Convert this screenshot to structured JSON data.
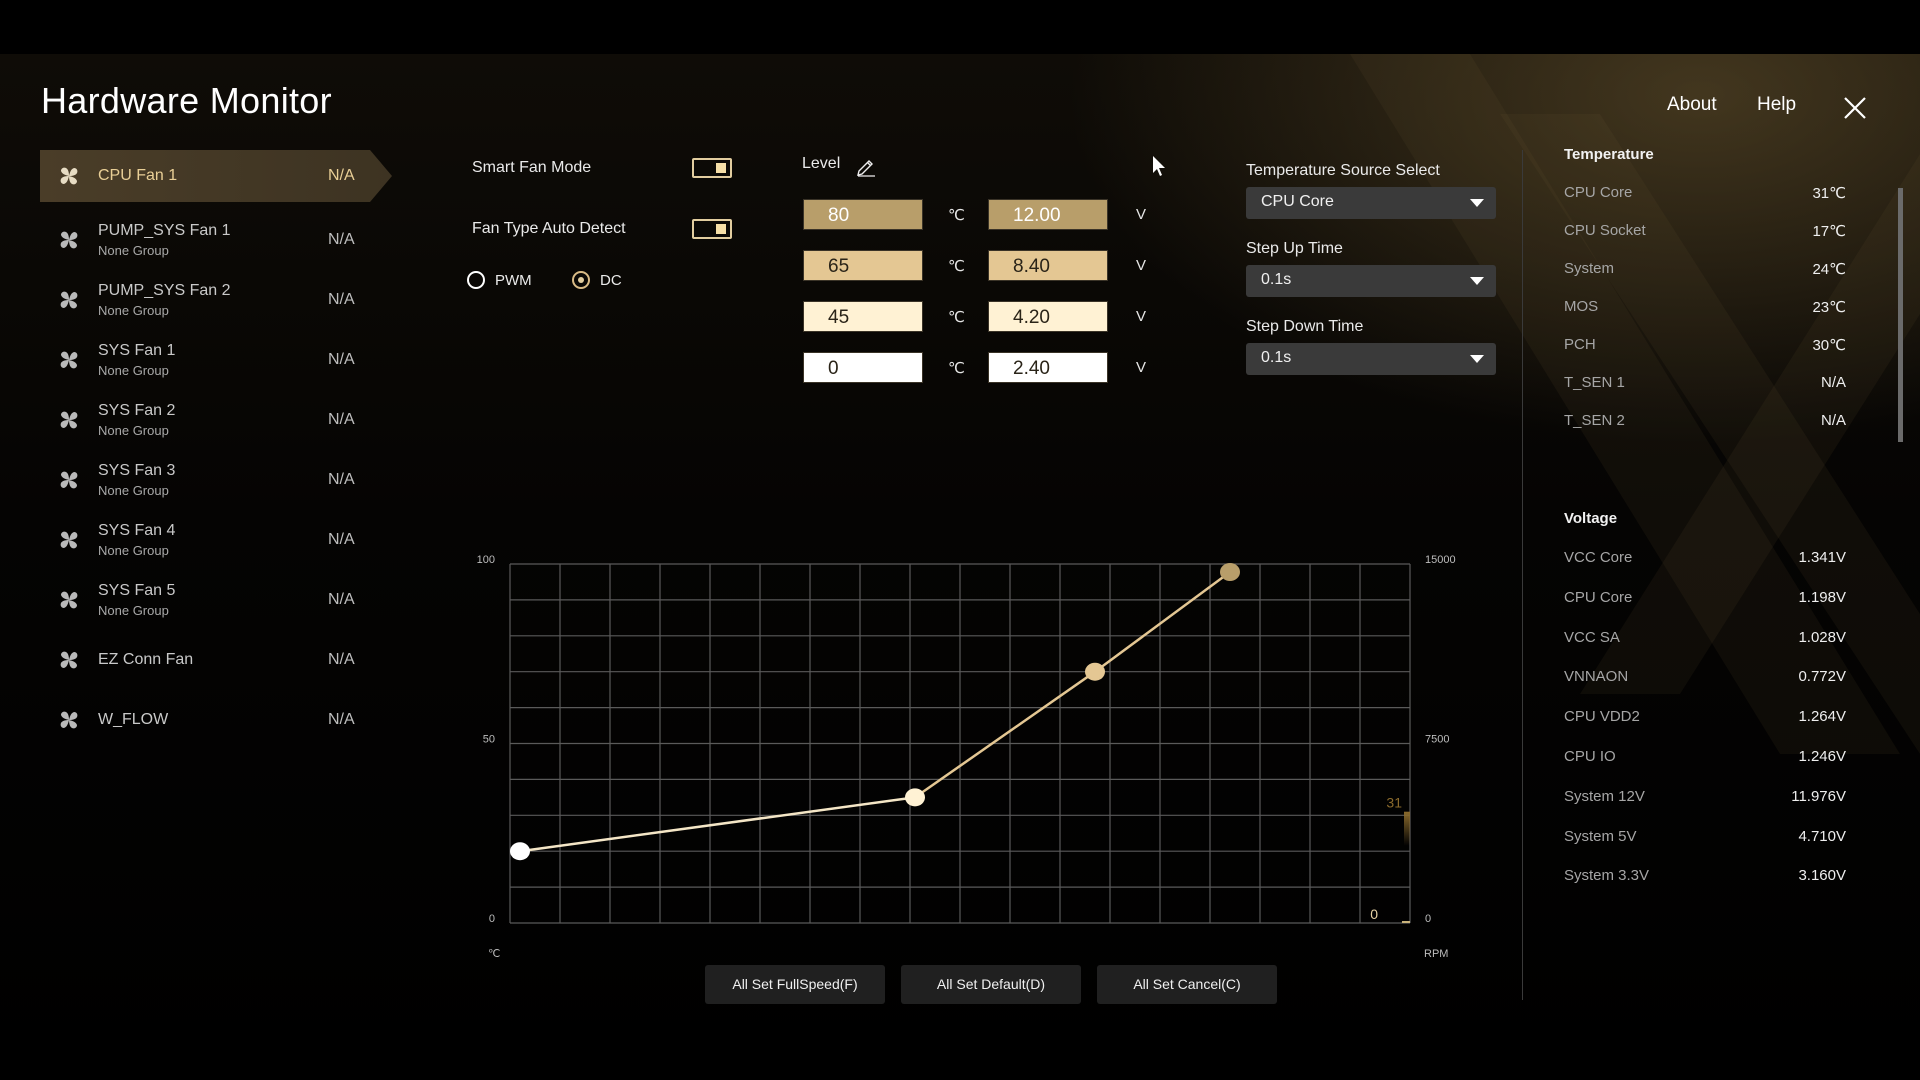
{
  "app": {
    "title": "Hardware Monitor",
    "header": {
      "about": "About",
      "help": "Help",
      "close_icon": "close-icon"
    }
  },
  "fans": [
    {
      "name": "CPU Fan 1",
      "group": "",
      "value": "N/A",
      "active": true
    },
    {
      "name": "PUMP_SYS Fan 1",
      "group": "None Group",
      "value": "N/A"
    },
    {
      "name": "PUMP_SYS Fan 2",
      "group": "None Group",
      "value": "N/A"
    },
    {
      "name": "SYS Fan 1",
      "group": "None Group",
      "value": "N/A"
    },
    {
      "name": "SYS Fan 2",
      "group": "None Group",
      "value": "N/A"
    },
    {
      "name": "SYS Fan 3",
      "group": "None Group",
      "value": "N/A"
    },
    {
      "name": "SYS Fan 4",
      "group": "None Group",
      "value": "N/A"
    },
    {
      "name": "SYS Fan 5",
      "group": "None Group",
      "value": "N/A"
    },
    {
      "name": "EZ Conn Fan",
      "group": "",
      "value": "N/A"
    },
    {
      "name": "W_FLOW",
      "group": "",
      "value": "N/A"
    }
  ],
  "controls": {
    "smart_fan_mode": {
      "label": "Smart Fan Mode",
      "on": true
    },
    "fan_type_auto_detect": {
      "label": "Fan Type Auto Detect",
      "on": true
    },
    "fan_type": {
      "options": [
        "PWM",
        "DC"
      ],
      "selected": "DC"
    },
    "level_label": "Level",
    "levels": [
      {
        "temp": "80",
        "volt": "12.00",
        "color": "#b89e6a",
        "text_color": "#ffffff"
      },
      {
        "temp": "65",
        "volt": "8.40",
        "color": "#e4c793",
        "text_color": "#2a2418"
      },
      {
        "temp": "45",
        "volt": "4.20",
        "color": "#fff2d4",
        "text_color": "#2a2418"
      },
      {
        "temp": "0",
        "volt": "2.40",
        "color": "#ffffff",
        "text_color": "#2a2418"
      }
    ],
    "temp_unit": "℃",
    "volt_unit": "V",
    "temperature_source": {
      "label": "Temperature Source Select",
      "value": "CPU Core"
    },
    "step_up_time": {
      "label": "Step Up Time",
      "value": "0.1s"
    },
    "step_down_time": {
      "label": "Step Down Time",
      "value": "0.1s"
    }
  },
  "chart_data": {
    "type": "line",
    "title": "",
    "xlabel": "℃",
    "ylabel_left": "",
    "ylabel_right": "RPM",
    "xlim": [
      0,
      100
    ],
    "ylim_left": [
      0,
      100
    ],
    "ylim_right": [
      0,
      15000
    ],
    "left_ticks": [
      "100",
      "50",
      "0"
    ],
    "right_ticks": [
      "15000",
      "7500",
      "0"
    ],
    "grid": true,
    "grid_columns": 18,
    "grid_rows": 10,
    "points": [
      {
        "temp": 0,
        "percent": 20,
        "color": "#ffffff"
      },
      {
        "temp": 45,
        "percent": 35,
        "color": "#fff2d4"
      },
      {
        "temp": 65,
        "percent": 70,
        "color": "#e4c793"
      },
      {
        "temp": 80,
        "percent": 100,
        "color": "#b89e6a"
      }
    ],
    "current_temp_label": "31",
    "current_temp_percent": 31,
    "current_rpm_label": "0",
    "line_color": "#e4c793"
  },
  "buttons": {
    "full_speed": "All Set FullSpeed(F)",
    "default": "All Set Default(D)",
    "cancel": "All Set Cancel(C)"
  },
  "monitor": {
    "temperature_title": "Temperature",
    "temperature": [
      {
        "name": "CPU Core",
        "value": "31℃"
      },
      {
        "name": "CPU Socket",
        "value": "17℃"
      },
      {
        "name": "System",
        "value": "24℃"
      },
      {
        "name": "MOS",
        "value": "23℃"
      },
      {
        "name": "PCH",
        "value": "30℃"
      },
      {
        "name": "T_SEN 1",
        "value": "N/A"
      },
      {
        "name": "T_SEN 2",
        "value": "N/A"
      }
    ],
    "voltage_title": "Voltage",
    "voltage": [
      {
        "name": "VCC Core",
        "value": "1.341V"
      },
      {
        "name": "CPU Core",
        "value": "1.198V"
      },
      {
        "name": "VCC SA",
        "value": "1.028V"
      },
      {
        "name": "VNNAON",
        "value": "0.772V"
      },
      {
        "name": "CPU VDD2",
        "value": "1.264V"
      },
      {
        "name": "CPU IO",
        "value": "1.246V"
      },
      {
        "name": "System 12V",
        "value": "11.976V"
      },
      {
        "name": "System 5V",
        "value": "4.710V"
      },
      {
        "name": "System 3.3V",
        "value": "3.160V"
      }
    ]
  }
}
